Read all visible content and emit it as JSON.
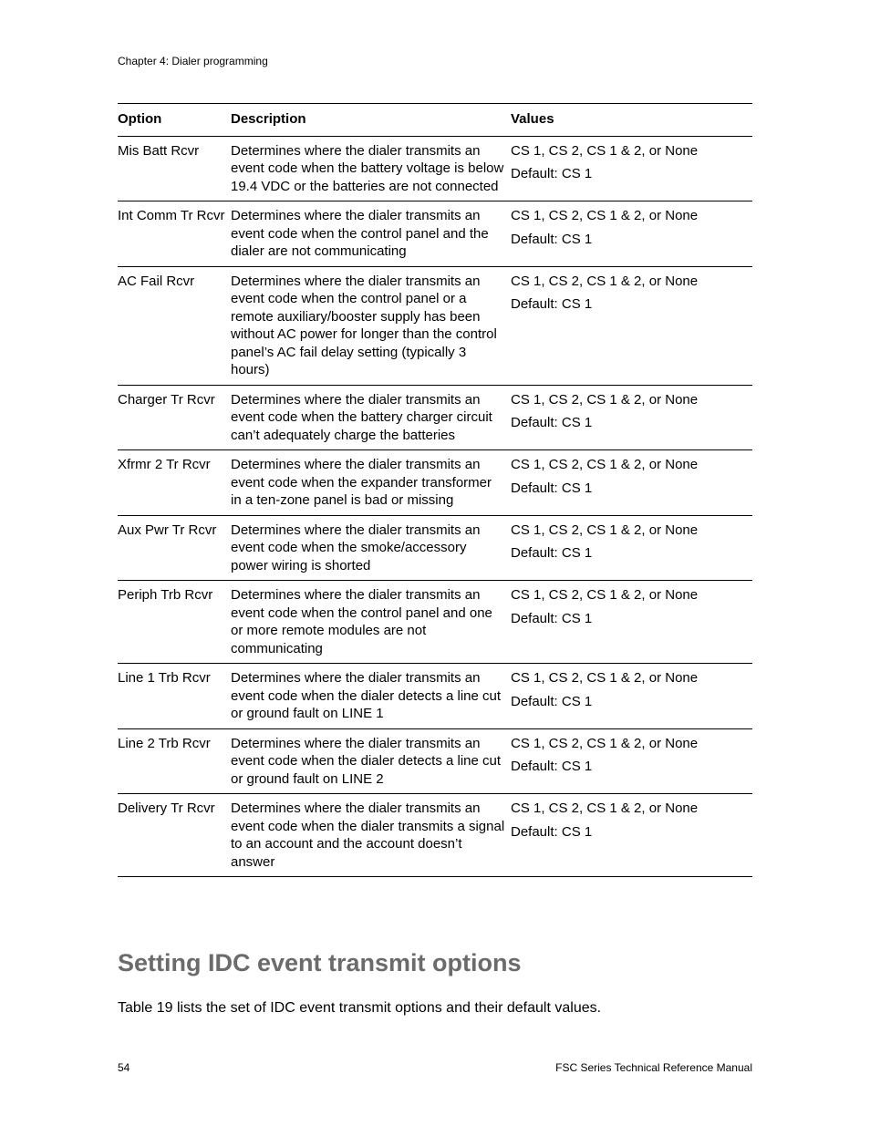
{
  "chapter_header": "Chapter 4: Dialer programming",
  "table": {
    "headers": {
      "option": "Option",
      "description": "Description",
      "values": "Values"
    },
    "rows": [
      {
        "option": "Mis Batt Rcvr",
        "description": "Determines where the dialer transmits an event code when the battery voltage is below 19.4 VDC or the batteries are not connected",
        "values": "CS 1, CS 2, CS 1 & 2, or None",
        "default": "Default: CS 1"
      },
      {
        "option": "Int Comm Tr Rcvr",
        "description": "Determines where the dialer transmits an event code when the control panel and the dialer are not communicating",
        "values": "CS 1, CS 2, CS 1 & 2, or None",
        "default": "Default: CS 1"
      },
      {
        "option": "AC Fail Rcvr",
        "description": "Determines where the dialer transmits an event code when the control panel or a remote auxiliary/booster supply has been without AC power for longer than the control panel’s AC fail delay setting (typically 3 hours)",
        "values": "CS 1, CS 2, CS 1 & 2, or None",
        "default": "Default: CS 1"
      },
      {
        "option": "Charger Tr Rcvr",
        "description": "Determines where the dialer transmits an event code when the battery charger circuit can’t adequately charge the batteries",
        "values": "CS 1, CS 2, CS 1 & 2, or None",
        "default": "Default: CS 1"
      },
      {
        "option": "Xfrmr 2 Tr Rcvr",
        "description": "Determines where the dialer transmits an event code when the expander transformer in a ten-zone panel is bad or missing",
        "values": "CS 1, CS 2, CS 1 & 2, or None",
        "default": "Default: CS 1"
      },
      {
        "option": "Aux Pwr Tr Rcvr",
        "description": "Determines where the dialer transmits an event code when the smoke/accessory power wiring is shorted",
        "values": "CS 1, CS 2, CS 1 & 2, or None",
        "default": "Default: CS 1"
      },
      {
        "option": "Periph Trb Rcvr",
        "description": "Determines where the dialer transmits an event code when the control panel and one or more remote modules are not communicating",
        "values": "CS 1, CS 2, CS 1 & 2, or None",
        "default": "Default: CS 1"
      },
      {
        "option": "Line 1 Trb Rcvr",
        "description": "Determines where the dialer transmits an event code when the dialer detects a line cut or ground fault on LINE 1",
        "values": "CS 1, CS 2, CS 1 & 2, or None",
        "default": "Default: CS 1"
      },
      {
        "option": "Line 2 Trb Rcvr",
        "description": "Determines where the dialer transmits an event code when the dialer detects a line cut or ground fault on LINE 2",
        "values": "CS 1, CS 2, CS 1 & 2, or None",
        "default": "Default: CS 1"
      },
      {
        "option": "Delivery Tr Rcvr",
        "description": "Determines where the dialer transmits an event code when the dialer transmits a signal to an account and the account doesn’t answer",
        "values": "CS 1, CS 2, CS 1 & 2, or None",
        "default": "Default: CS 1"
      }
    ]
  },
  "section_heading": "Setting IDC event transmit options",
  "section_intro": "Table 19 lists the set of IDC event transmit options and their default values.",
  "footer": {
    "page": "54",
    "title": "FSC Series Technical Reference Manual"
  }
}
